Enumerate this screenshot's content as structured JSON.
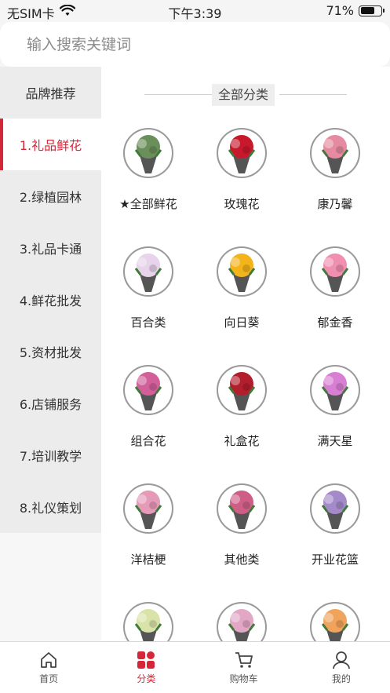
{
  "status": {
    "carrier": "无SIM卡",
    "time": "下午3:39",
    "battery": "71%",
    "battery_level": 0.71
  },
  "search": {
    "placeholder": "输入搜索关键词"
  },
  "sidebar": {
    "items": [
      {
        "label": "品牌推荐"
      },
      {
        "label": "1.礼品鲜花"
      },
      {
        "label": "2.绿植园林"
      },
      {
        "label": "3.礼品卡通"
      },
      {
        "label": "4.鲜花批发"
      },
      {
        "label": "5.资材批发"
      },
      {
        "label": "6.店铺服务"
      },
      {
        "label": "7.培训教学"
      },
      {
        "label": "8.礼仪策划"
      }
    ],
    "active_index": 1
  },
  "main": {
    "section_title": "全部分类",
    "categories": [
      {
        "label": "★全部鲜花",
        "icon": "flower-shop-photo",
        "color": "#6b8f5a"
      },
      {
        "label": "玫瑰花",
        "icon": "red-rose-bouquet-photo",
        "color": "#c8192c"
      },
      {
        "label": "康乃馨",
        "icon": "carnation-bouquet-photo",
        "color": "#e58aa0"
      },
      {
        "label": "百合类",
        "icon": "lily-bouquet-photo",
        "color": "#e7d3ea"
      },
      {
        "label": "向日葵",
        "icon": "sunflower-bouquet-photo",
        "color": "#f2b31b"
      },
      {
        "label": "郁金香",
        "icon": "tulip-bouquet-photo",
        "color": "#f08fb0"
      },
      {
        "label": "组合花",
        "icon": "mixed-bouquet-photo",
        "color": "#d25e9a"
      },
      {
        "label": "礼盒花",
        "icon": "flower-gift-box-photo",
        "color": "#b31e2d"
      },
      {
        "label": "满天星",
        "icon": "babys-breath-bouquet-photo",
        "color": "#d77fd3"
      },
      {
        "label": "洋桔梗",
        "icon": "eustoma-bouquet-photo",
        "color": "#e59ab8"
      },
      {
        "label": "其他类",
        "icon": "dahlia-bouquet-photo",
        "color": "#cf5e86"
      },
      {
        "label": "开业花篮",
        "icon": "opening-flower-basket-photo",
        "color": "#a58ac9"
      },
      {
        "label": "",
        "icon": "lily-bouquet-photo",
        "color": "#d9e3a8"
      },
      {
        "label": "",
        "icon": "mixed-bouquet-photo",
        "color": "#e1a7c4"
      },
      {
        "label": "",
        "icon": "single-flower-bundles-photo",
        "color": "#f0a35a"
      }
    ]
  },
  "tabbar": {
    "items": [
      {
        "label": "首页",
        "icon": "home-icon"
      },
      {
        "label": "分类",
        "icon": "category-icon"
      },
      {
        "label": "购物车",
        "icon": "cart-icon"
      },
      {
        "label": "我的",
        "icon": "profile-icon"
      }
    ],
    "active_index": 1
  },
  "colors": {
    "accent": "#d4283a",
    "sidebar_bg": "#ececec",
    "background": "#f5f5f5"
  }
}
